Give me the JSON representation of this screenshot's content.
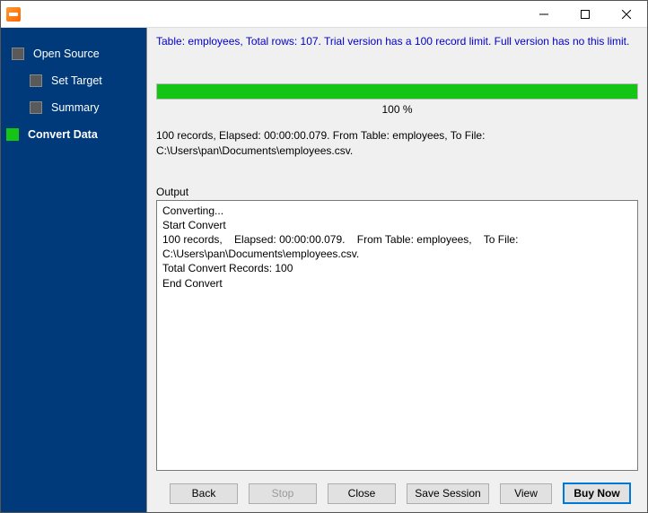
{
  "titlebar": {
    "title": ""
  },
  "sidebar": {
    "items": [
      {
        "label": "Open Source",
        "active": false
      },
      {
        "label": "Set Target",
        "active": false
      },
      {
        "label": "Summary",
        "active": false
      },
      {
        "label": "Convert Data",
        "active": true
      }
    ]
  },
  "main": {
    "info_message": "Table: employees, Total rows: 107. Trial version has a 100 record limit. Full version has no this limit.",
    "progress": {
      "percent_text": "100 %",
      "percent_value": 100
    },
    "status_text": "100 records,    Elapsed: 00:00:00.079.    From Table: employees,    To File: C:\\Users\\pan\\Documents\\employees.csv.",
    "output": {
      "label": "Output",
      "text": "Converting...\nStart Convert\n100 records,    Elapsed: 00:00:00.079.    From Table: employees,    To File: C:\\Users\\pan\\Documents\\employees.csv.\nTotal Convert Records: 100\nEnd Convert"
    }
  },
  "buttons": {
    "back": "Back",
    "stop": "Stop",
    "close": "Close",
    "save_session": "Save Session",
    "view": "View",
    "buy_now": "Buy Now"
  }
}
